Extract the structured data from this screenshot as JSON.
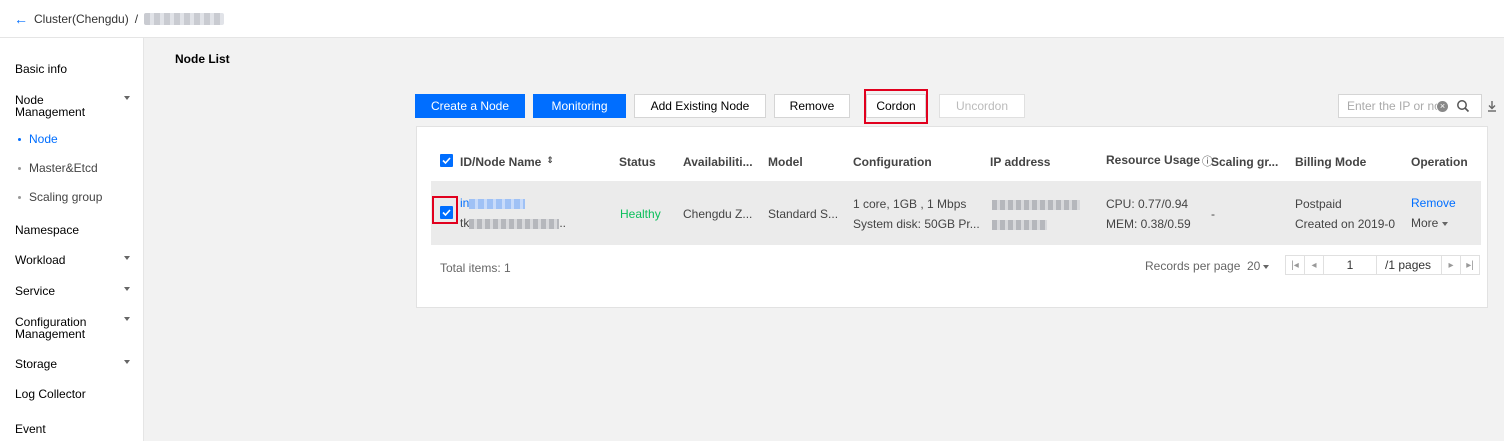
{
  "breadcrumb": {
    "cluster": "Cluster(Chengdu)",
    "separator": "/"
  },
  "sidebar": {
    "basic_info": "Basic info",
    "node_management": [
      "Node",
      "Management"
    ],
    "sub_items": [
      "Node",
      "Master&Etcd",
      "Scaling group"
    ],
    "namespace": "Namespace",
    "workload": "Workload",
    "service": "Service",
    "config_management": [
      "Configuration",
      "Management"
    ],
    "storage": "Storage",
    "log_collector": "Log Collector",
    "event": "Event"
  },
  "page": {
    "title": "Node List"
  },
  "toolbar": {
    "create_node": "Create a Node",
    "monitoring": "Monitoring",
    "add_existing": "Add Existing Node",
    "remove": "Remove",
    "cordon": "Cordon",
    "uncordon": "Uncordon",
    "search_placeholder": "Enter the IP or no"
  },
  "table": {
    "headers": {
      "id": "ID/Node Name",
      "status": "Status",
      "availability": "Availabiliti...",
      "model": "Model",
      "configuration": "Configuration",
      "ip": "IP address",
      "resource": "Resource Usage",
      "scaling": "Scaling gr...",
      "billing": "Billing Mode",
      "operation": "Operation"
    },
    "row": {
      "id_prefix": "in",
      "name_prefix": "tk",
      "name_suffix": "..",
      "status": "Healthy",
      "availability": "Chengdu Z...",
      "model": "Standard S...",
      "config_line1": "1 core, 1GB , 1 Mbps",
      "config_line2": "System disk: 50GB Pr...",
      "cpu": "CPU: 0.77/0.94",
      "mem": "MEM: 0.38/0.59",
      "scaling": "-",
      "billing_line1": "Postpaid",
      "billing_line2": "Created on 2019-0",
      "op_remove": "Remove",
      "op_more": "More"
    }
  },
  "footer": {
    "total": "Total items: 1",
    "records_per_page": "Records per page",
    "page_size": "20",
    "current_page": "1",
    "total_pages": "/1 pages"
  },
  "colors": {
    "accent": "#006eff",
    "healthy": "#0abf5b",
    "highlight": "#e1001e"
  }
}
